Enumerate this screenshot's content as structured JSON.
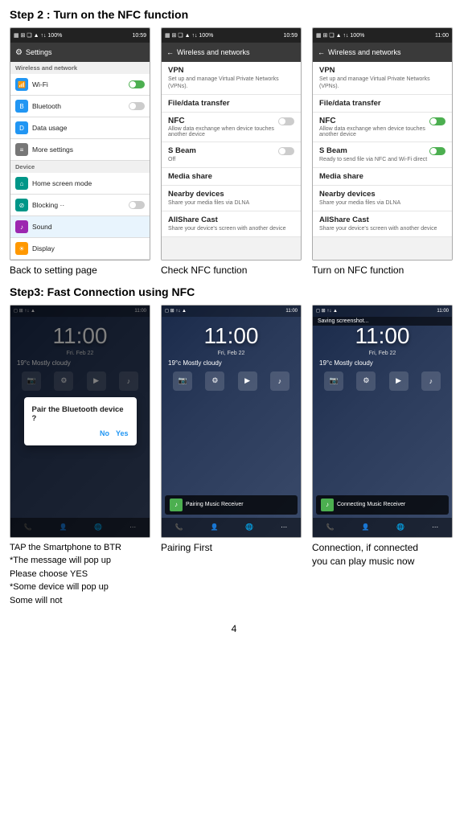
{
  "step2": {
    "title": "Step 2 : Turn on the NFC function",
    "screenshots": [
      {
        "id": "settings",
        "caption": "Back to setting page",
        "topbar_time": "10:59",
        "header": "Settings",
        "sections": [
          {
            "label": "Wireless and network",
            "is_label": true
          },
          {
            "name": "Wi-Fi",
            "icon": "wifi",
            "color": "blue",
            "toggle": "on"
          },
          {
            "name": "Bluetooth",
            "icon": "bt",
            "color": "blue",
            "toggle": "off"
          },
          {
            "name": "Data usage",
            "icon": "data",
            "color": "blue",
            "toggle": ""
          },
          {
            "name": "More settings",
            "icon": "more",
            "color": "gray",
            "toggle": ""
          },
          {
            "label": "Device",
            "is_label": true
          },
          {
            "name": "Home screen mode",
            "icon": "home",
            "color": "teal",
            "toggle": ""
          },
          {
            "name": "Blocking ··",
            "icon": "block",
            "color": "teal",
            "toggle": "off"
          },
          {
            "name": "Sound",
            "icon": "sound",
            "color": "purple",
            "highlighted": true,
            "toggle": ""
          },
          {
            "name": "Display",
            "icon": "display",
            "color": "orange",
            "toggle": ""
          }
        ]
      },
      {
        "id": "wireless_off",
        "caption": "Check NFC function",
        "topbar_time": "10:59",
        "header": "Wireless and networks",
        "items": [
          {
            "name": "VPN",
            "sub": "Set up and manage Virtual Private Networks (VPNs)."
          },
          {
            "name": "File/data transfer",
            "sub": ""
          },
          {
            "name": "NFC",
            "sub": "Allow data exchange when device touches another device",
            "toggle": "off"
          },
          {
            "name": "S Beam",
            "sub": "Off",
            "toggle": "off"
          },
          {
            "name": "Media share",
            "sub": ""
          },
          {
            "name": "Nearby devices",
            "sub": "Share your media files via DLNA"
          },
          {
            "name": "AllShare Cast",
            "sub": "Share your device's screen with another device"
          }
        ]
      },
      {
        "id": "wireless_on",
        "caption": "Turn on NFC function",
        "topbar_time": "11:00",
        "header": "Wireless and networks",
        "items": [
          {
            "name": "VPN",
            "sub": "Set up and manage Virtual Private Networks (VPNs)."
          },
          {
            "name": "File/data transfer",
            "sub": ""
          },
          {
            "name": "NFC",
            "sub": "Allow data exchange when device touches another device",
            "toggle": "on"
          },
          {
            "name": "S Beam",
            "sub": "Ready to send file via NFC and Wi-Fi direct",
            "toggle": "on"
          },
          {
            "name": "Media share",
            "sub": ""
          },
          {
            "name": "Nearby devices",
            "sub": "Share your media files via DLNA"
          },
          {
            "name": "AllShare Cast",
            "sub": "Share your device's screen with another device"
          }
        ]
      }
    ]
  },
  "step3": {
    "title": "Step3: Fast Connection using NFC",
    "screenshots": [
      {
        "id": "phone_dialog",
        "time": "11:00",
        "date": "Fri. Feb 22",
        "weather": "19°c  Mostly cloudy",
        "dialog_title": "Pair the Bluetooth device ?",
        "dialog_no": "No",
        "dialog_yes": "Yes",
        "caption": "TAP the Smartphone to BTR",
        "subcaptions": [
          "*The message will pop up",
          "Please choose YES",
          "*Some device will pop up",
          "Some will not"
        ]
      },
      {
        "id": "phone_pairing",
        "time": "11:00",
        "date": "Fri, Feb 22",
        "weather": "19°c  Mostly cloudy",
        "pairing_text": "Pairing Music Receiver",
        "caption": "Pairing First"
      },
      {
        "id": "phone_connected",
        "time": "11:00",
        "date": "Fri, Feb 22",
        "weather": "19°c  Mostly cloudy",
        "pairing_text": "Connecting Music Receiver",
        "saving_text": "Saving screenshot...",
        "caption": "Connection, if connected",
        "subcaption": "you can play music now"
      }
    ]
  },
  "page_number": "4"
}
